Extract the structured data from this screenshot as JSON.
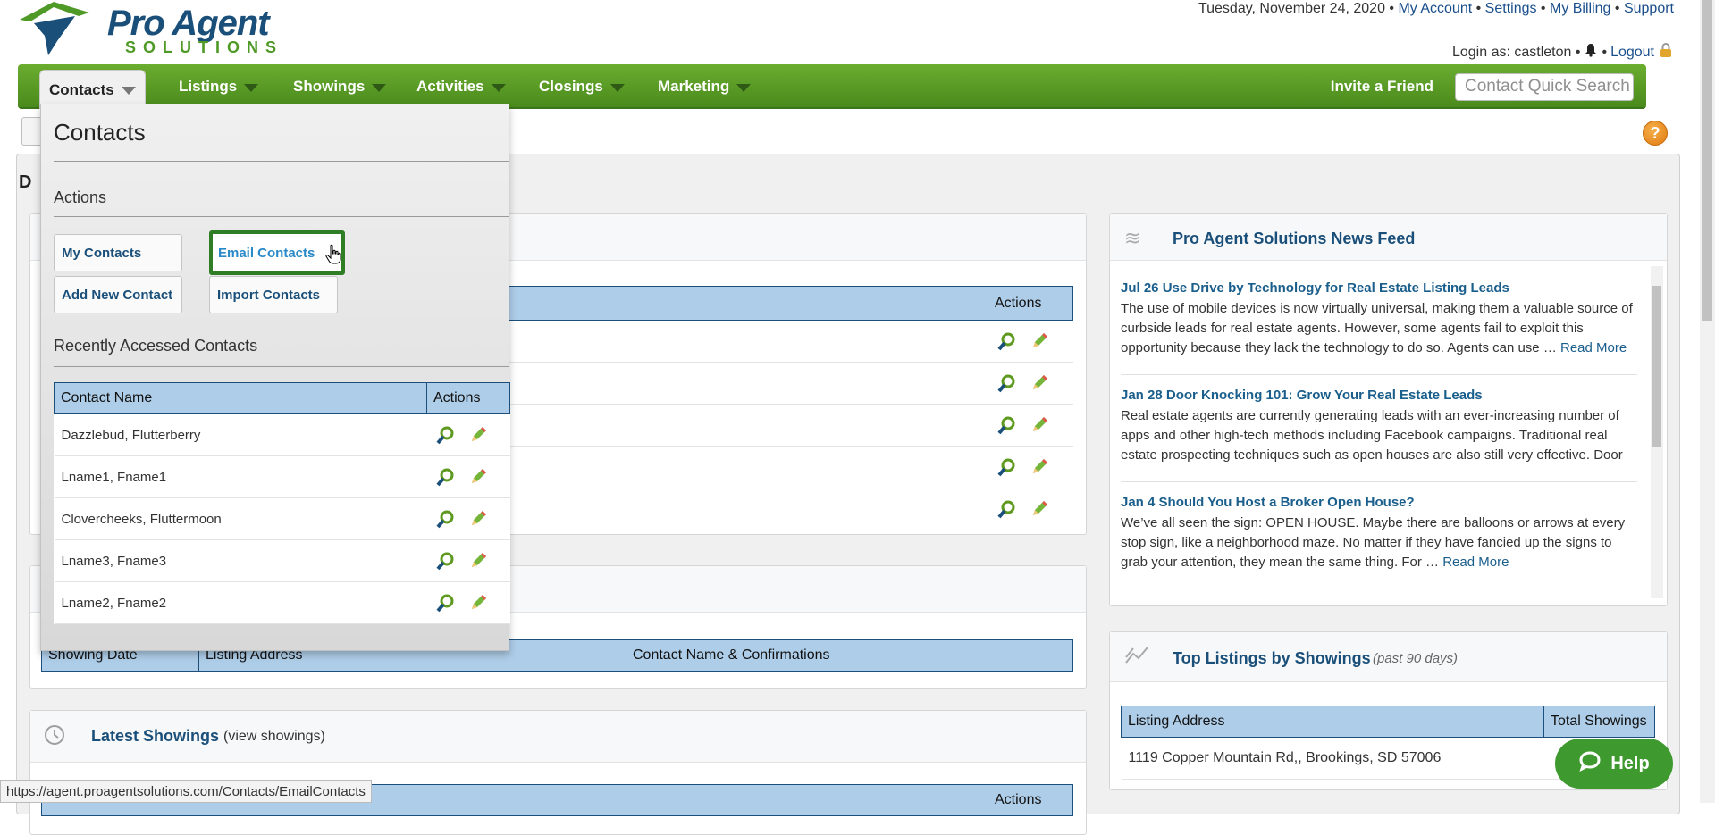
{
  "logo": {
    "line1": "Pro Agent",
    "line2": "SOLUTIONS"
  },
  "top_bar": {
    "date": "Tuesday, November 24, 2020",
    "sep": " • ",
    "my_account": "My Account",
    "settings": "Settings",
    "my_billing": "My Billing",
    "support": "Support",
    "login_as": "Login as: castleton •",
    "logout": "Logout"
  },
  "nav": {
    "items": [
      {
        "label": "Contacts"
      },
      {
        "label": "Listings"
      },
      {
        "label": "Showings"
      },
      {
        "label": "Activities"
      },
      {
        "label": "Closings"
      },
      {
        "label": "Marketing"
      }
    ],
    "invite": "Invite a Friend",
    "quick_search_placeholder": "Contact Quick Search"
  },
  "dropdown": {
    "title": "Contacts",
    "actions_heading": "Actions",
    "buttons": {
      "my_contacts": "My Contacts",
      "email_contacts": "Email Contacts",
      "add_new_contact": "Add New Contact",
      "import_contacts": "Import Contacts"
    },
    "recent_heading": "Recently Accessed Contacts",
    "table_headers": [
      "Contact Name",
      "Actions"
    ],
    "recent_contacts": [
      "Dazzlebud, Flutterberry",
      "Lname1, Fname1",
      "Clovercheeks, Fluttermoon",
      "Lname3, Fname3",
      "Lname2, Fname2"
    ]
  },
  "left_panel1": {
    "actions_header": "Actions"
  },
  "showings_table": {
    "headers": [
      "Showing Date",
      "Listing Address",
      "Contact Name & Confirmations"
    ]
  },
  "latest_showings": {
    "title": "Latest Showings",
    "link": "(view showings)",
    "actions_header": "Actions"
  },
  "news_feed": {
    "title": "Pro Agent Solutions News Feed",
    "items": [
      {
        "title": "Jul 26 Use Drive by Technology for Real Estate Listing Leads",
        "body": "The use of mobile devices is now virtually universal, making them a valuable source of curbside leads for real estate agents. However, some agents fail to exploit this opportunity because they lack the technology to do so. Agents can use …",
        "more": "Read More"
      },
      {
        "title": "Jan 28 Door Knocking 101: Grow Your Real Estate Leads",
        "body": "Real estate agents are currently generating leads with an ever-increasing number of apps and other high-tech methods including Facebook campaigns. Traditional real estate prospecting techniques such as open houses are also still very effective. Door",
        "more": ""
      },
      {
        "title": "Jan 4 Should You Host a Broker Open House?",
        "body": "We’ve all seen the sign: OPEN HOUSE. Maybe there are balloons or arrows at every stop sign, like a neighborhood maze. No matter if they have fancied up the signs to grab your attention, they mean the same thing. For …",
        "more": "Read More"
      }
    ]
  },
  "top_listings": {
    "title": "Top Listings by Showings",
    "subtitle": "(past 90 days)",
    "headers": [
      "Listing Address",
      "Total Showings"
    ],
    "rows": [
      {
        "address": "1119 Copper Mountain Rd,, Brookings, SD 57006"
      }
    ]
  },
  "help_bubble": "Help",
  "status_url": "https://agent.proagentsolutions.com/Contacts/EmailContacts",
  "dashboard_letter": "D",
  "help_icon": "?",
  "colors": {
    "nav_green": "#5a9c26",
    "header_blue": "#aecde8",
    "link_blue": "#1a4f7a",
    "focus_green": "#2f7d24"
  }
}
